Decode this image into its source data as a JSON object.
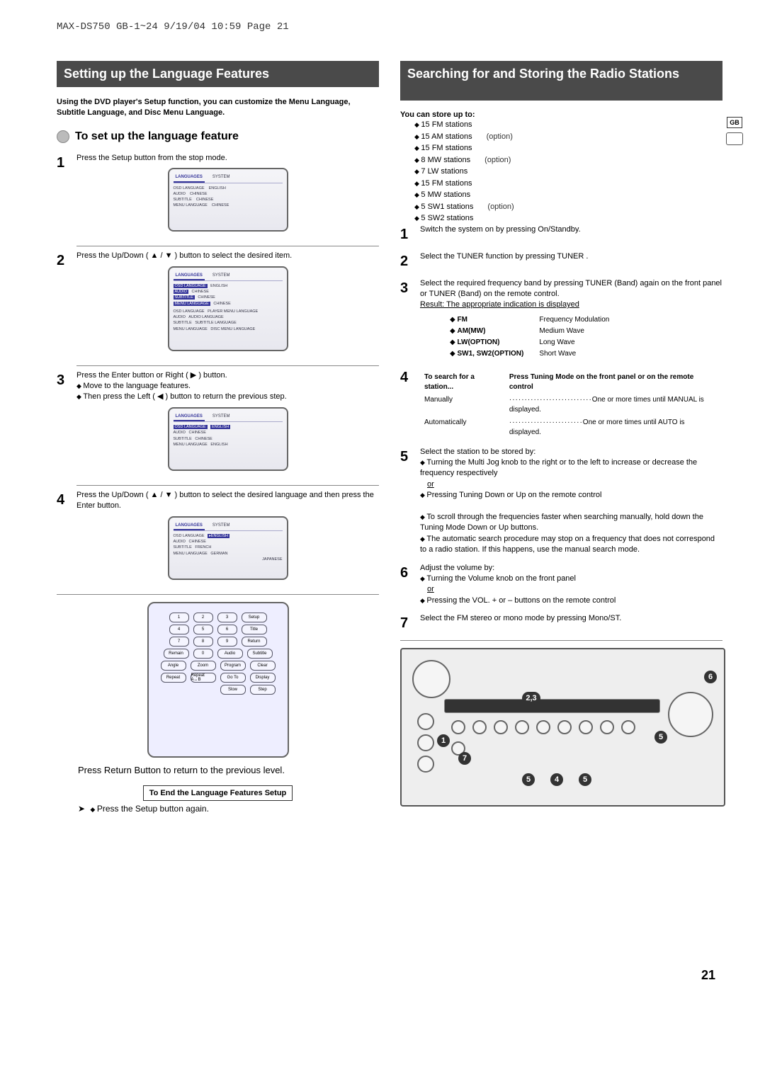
{
  "meta": {
    "header": "MAX-DS750 GB-1~24  9/19/04 10:59  Page 21",
    "page_num": "21",
    "side_badge": "GB"
  },
  "left": {
    "title": "Setting up the Language Features",
    "intro": "Using the DVD player's Setup function, you can customize the Menu Language, Subtitle Language, and Disc Menu Language.",
    "subhead": "To set up the language feature",
    "step1": "Press the Setup button from the stop mode.",
    "step2": "Press the Up/Down ( ▲ / ▼ ) button  to select the desired item.",
    "step3_a": "Press the Enter button or Right ( ▶ ) button.",
    "step3_b": "Move to the language features.",
    "step3_c": "Then press the Left ( ◀ ) button to return the previous step.",
    "step4": "Press the Up/Down ( ▲ / ▼ ) button to select the desired language and then press the Enter button.",
    "return_note": "Press Return Button to  return to the previous level.",
    "end_box": "To End the Language Features Setup",
    "end_note": "Press the Setup button again.",
    "osd": {
      "tab_lang": "LANGUAGES",
      "tab_sys": "SYSTEM",
      "r1": "OSD LANGUAGE",
      "v1": "ENGLISH",
      "r2": "AUDIO",
      "v2": "CHINESE",
      "r3": "SUBTITLE",
      "v3": "CHINESE",
      "r4": "MENU LANGUAGE",
      "v4": "CHINESE",
      "v4b": "FRENCH",
      "v4c": "GERMAN",
      "v4d": "JAPANESE",
      "a_player": "PLAYER MENU LANGUAGE",
      "a_audio": "AUDIO LANGUAGE",
      "a_sub": "SUBTITLE LANGUAGE",
      "a_disc": "DISC MENU LANGUAGE"
    },
    "remote": {
      "k1": "1",
      "k2": "2",
      "k3": "3",
      "k4": "4",
      "k5": "5",
      "k6": "6",
      "k7": "7",
      "k8": "8",
      "k9": "9",
      "k0": "0",
      "setup": "Setup",
      "title": "Title",
      "return": "Return",
      "subtitle": "Subtitle",
      "remain": "Remain",
      "audio": "Audio",
      "angle": "Angle",
      "zoom": "Zoom",
      "program": "Program",
      "clear": "Clear",
      "repeat": "Repeat",
      "repeatab": "Repeat A↔B",
      "goto": "Go To",
      "display": "Display",
      "slow": "Slow",
      "step": "Step"
    }
  },
  "right": {
    "title": "Searching for and Storing the Radio Stations",
    "store_hdr": "You can store up to:",
    "stations": [
      "15 FM stations",
      "15 AM stations",
      "15 FM stations",
      "8 MW stations",
      "7 LW stations",
      "15 FM stations",
      "5 MW stations",
      "5 SW1 stations",
      "5 SW2 stations"
    ],
    "opt": "(option)",
    "s1": "Switch the system on by pressing On/Standby.",
    "s2": "Select the TUNER function by pressing TUNER .",
    "s3a": "Select the required frequency band by pressing TUNER (Band) again on the front panel or TUNER (Band) on the remote control.",
    "s3b": "Result: The appropriate indication is displayed",
    "band_fm": "FM",
    "band_fm_d": "Frequency Modulation",
    "band_am": "AM(MW)",
    "band_am_d": "Medium Wave",
    "band_lw": "LW(OPTION)",
    "band_lw_d": "Long Wave",
    "band_sw": "SW1, SW2(OPTION)",
    "band_sw_d": "Short Wave",
    "s4_h1": "To search for a station...",
    "s4_h2": "Press Tuning Mode on the front panel or  on the remote control",
    "s4_m": "Manually",
    "s4_m_d": "One or more times until MANUAL is displayed.",
    "s4_a": "Automatically",
    "s4_a_d": "One or more times until AUTO  is displayed.",
    "s5a": "Select the station to be stored by:",
    "s5b": "Turning the Multi Jog knob to the right or to the left to increase or decrease the frequency respectively",
    "s5or": "or",
    "s5c": "Pressing Tuning Down or Up on the remote control",
    "s5d": "To scroll through the frequencies faster when searching manually, hold down the Tuning Mode Down or Up buttons.",
    "s5e": "The automatic search procedure may stop on a frequency that does not correspond to a radio station. If this happens, use the manual search mode.",
    "s6a": "Adjust the volume by:",
    "s6b": "Turning the Volume knob on the front panel",
    "s6c": "Pressing the VOL. + or – buttons on the remote control",
    "s7": "Select the FM stereo or mono mode by pressing Mono/ST.",
    "call_1": "1",
    "call_23": "2,3",
    "call_4": "4",
    "call_5": "5",
    "call_6": "6",
    "call_7": "7"
  }
}
